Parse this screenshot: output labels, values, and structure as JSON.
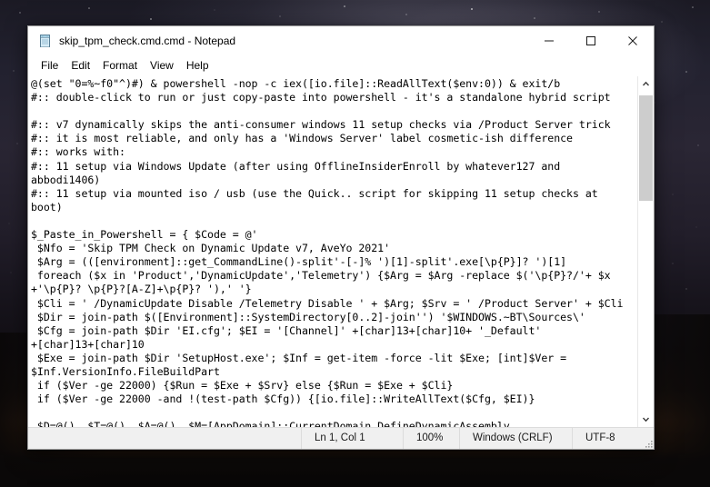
{
  "desktop": {
    "wallpaper_description": "starry-night-sky-over-sunset-horizon",
    "sky_color": "#232230",
    "horizon_glow_color": "#7a4415"
  },
  "window": {
    "app_name": "Notepad",
    "file_name": "skip_tpm_check.cmd.cmd",
    "title": "skip_tpm_check.cmd.cmd - Notepad",
    "icon": "notepad-icon",
    "controls": {
      "minimize": "─",
      "maximize": "☐",
      "close": "✕",
      "minimize_name": "minimize",
      "maximize_name": "maximize",
      "close_name": "close"
    }
  },
  "menubar": {
    "items": [
      {
        "label": "File"
      },
      {
        "label": "Edit"
      },
      {
        "label": "Format"
      },
      {
        "label": "View"
      },
      {
        "label": "Help"
      }
    ]
  },
  "editor": {
    "word_wrap": true,
    "lines": [
      "@(set \"0=%~f0\"^)#) & powershell -nop -c iex([io.file]::ReadAllText($env:0)) & exit/b",
      "#:: double-click to run or just copy-paste into powershell - it's a standalone hybrid script",
      "",
      "#:: v7 dynamically skips the anti-consumer windows 11 setup checks via /Product Server trick",
      "#:: it is most reliable, and only has a 'Windows Server' label cosmetic-ish difference",
      "#:: works with:",
      "#:: 11 setup via Windows Update (after using OfflineInsiderEnroll by whatever127 and",
      "abbodi1406)",
      "#:: 11 setup via mounted iso / usb (use the Quick.. script for skipping 11 setup checks at",
      "boot)",
      "",
      "$_Paste_in_Powershell = { $Code = @'",
      " $Nfo = 'Skip TPM Check on Dynamic Update v7, AveYo 2021'",
      " $Arg = (([environment]::get_CommandLine()-split'-[-]% ')[1]-split'.exe[\\p{P}]? ')[1]",
      " foreach ($x in 'Product','DynamicUpdate','Telemetry') {$Arg = $Arg -replace $('\\p{P}?/'+ $x",
      "+'\\p{P}? \\p{P}?[A-Z]+\\p{P}? '),' '}",
      " $Cli = ' /DynamicUpdate Disable /Telemetry Disable ' + $Arg; $Srv = ' /Product Server' + $Cli",
      " $Dir = join-path $([Environment]::SystemDirectory[0..2]-join'') '$WINDOWS.~BT\\Sources\\'",
      " $Cfg = join-path $Dir 'EI.cfg'; $EI = '[Channel]' +[char]13+[char]10+ '_Default'",
      "+[char]13+[char]10",
      " $Exe = join-path $Dir 'SetupHost.exe'; $Inf = get-item -force -lit $Exe; [int]$Ver =",
      "$Inf.VersionInfo.FileBuildPart",
      " if ($Ver -ge 22000) {$Run = $Exe + $Srv} else {$Run = $Exe + $Cli}",
      " if ($Ver -ge 22000 -and !(test-path $Cfg)) {[io.file]::WriteAllText($Cfg, $EI)}",
      "",
      " $D=@(), $T=@(), $A=@(), $M=[AppDomain]::CurrentDomain.DefineDynamicAssembly"
    ]
  },
  "scrollbar": {
    "up_arrow": "˄",
    "down_arrow": "˅",
    "thumb_name": "scrollbar-thumb",
    "position_percent": 0
  },
  "statusbar": {
    "cursor_position": "Ln 1, Col 1",
    "zoom": "100%",
    "line_ending": "Windows (CRLF)",
    "encoding": "UTF-8"
  }
}
